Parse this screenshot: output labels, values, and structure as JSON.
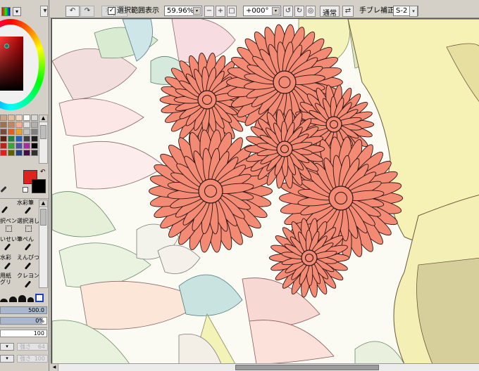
{
  "toolbar": {
    "selection_checkbox_label": "選択範囲表示",
    "zoom": "59.96%",
    "rotation": "+000°",
    "mode": "通常",
    "stabilizer_label": "手ブレ補正",
    "stabilizer_value": "S-2"
  },
  "tools": {
    "row1": [
      "",
      "水彩筆"
    ],
    "row2": [
      "択ペン",
      "選択消し"
    ],
    "row3": [
      "いせい",
      "筆ぺん"
    ],
    "row4": [
      "水彩",
      "えんぴつ"
    ],
    "row5": [
      "用紙",
      "クレヨン"
    ],
    "row6": [
      "グリ",
      ""
    ]
  },
  "brush": {
    "size": "500.0",
    "size_fill": 1.0,
    "density": "0%",
    "density_fill": 0.9,
    "edge": "100",
    "blend_label": "強さ",
    "blend_value": "64",
    "dilution_label": "強さ",
    "dilution_value": "100"
  },
  "colors": {
    "foreground": "#e0221f",
    "background": "#000000",
    "panel": "#d4d0c8",
    "flower_red": "#f28a74",
    "line_dark": "#2b1212"
  }
}
